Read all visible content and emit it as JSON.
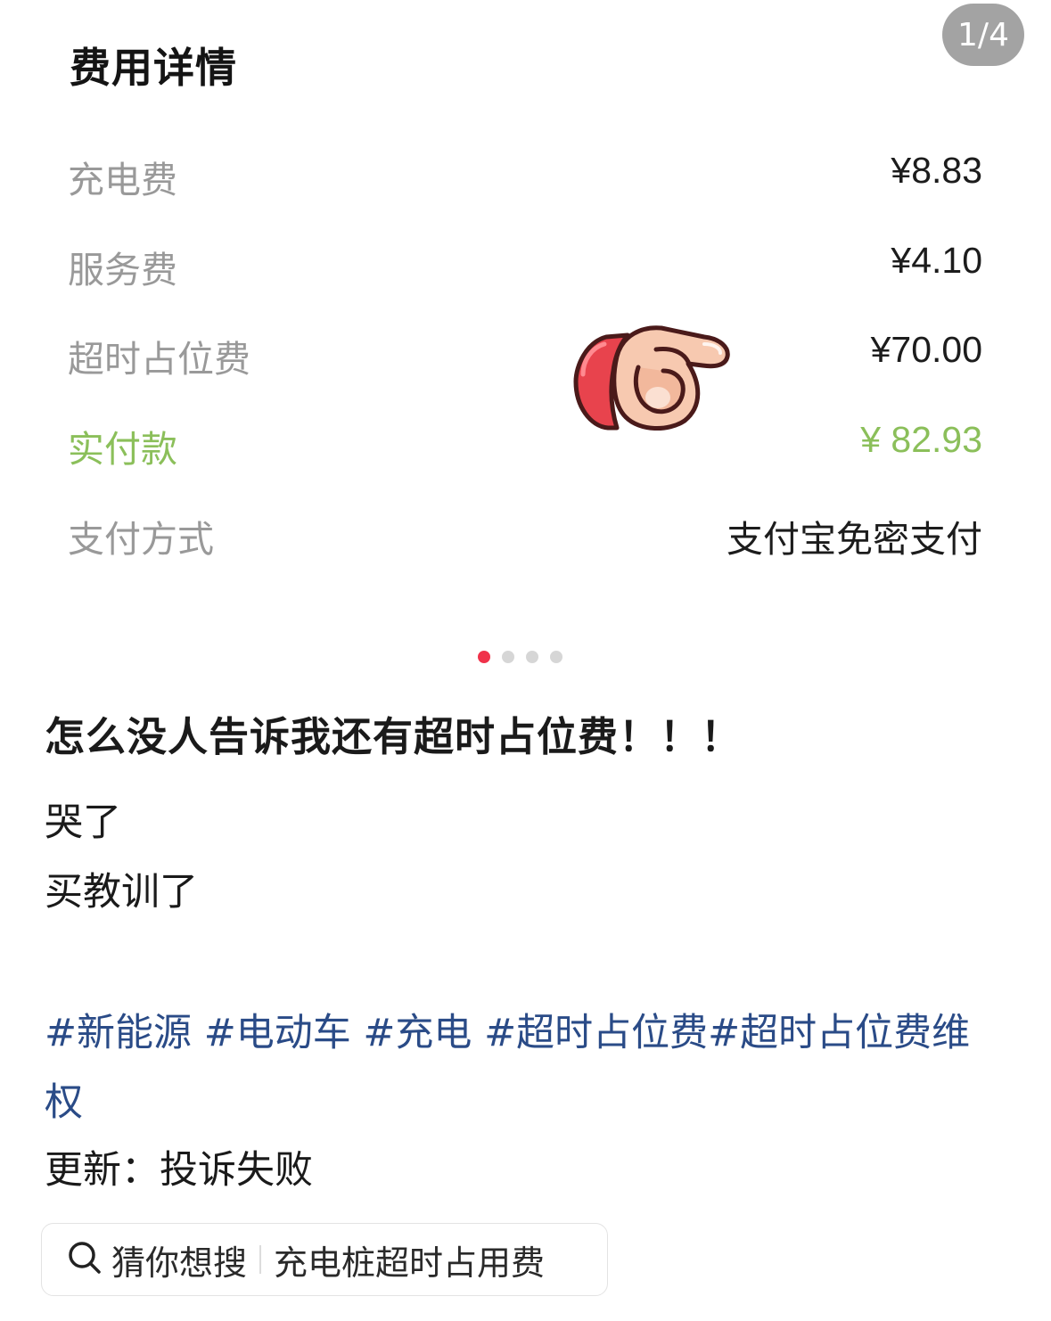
{
  "header": {
    "title": "费用详情",
    "page_indicator": "1/4"
  },
  "fee_rows": [
    {
      "label": "充电费",
      "value": "¥8.83"
    },
    {
      "label": "服务费",
      "value": "¥4.10"
    },
    {
      "label": "超时占位费",
      "value": "¥70.00"
    },
    {
      "label": "实付款",
      "value": "¥ 82.93"
    },
    {
      "label": "支付方式",
      "value": "支付宝免密支付"
    }
  ],
  "emoji": {
    "icon": "pointing-hand-icon"
  },
  "carousel": {
    "count": 4,
    "active_index": 0
  },
  "post": {
    "title": "怎么没人告诉我还有超时占位费！！！",
    "lines": [
      "哭了",
      "买教训了"
    ],
    "tags": [
      "#新能源",
      "#电动车",
      "#充电",
      "#超时占位费",
      "#超时占位费维权"
    ],
    "update": "更新：投诉失败"
  },
  "search": {
    "label": "猜你想搜",
    "query": "充电桩超时占用费"
  },
  "colors": {
    "accent_green": "#8bbf5a",
    "tag_blue": "#2a4b87",
    "active_dot": "#f0324a"
  }
}
